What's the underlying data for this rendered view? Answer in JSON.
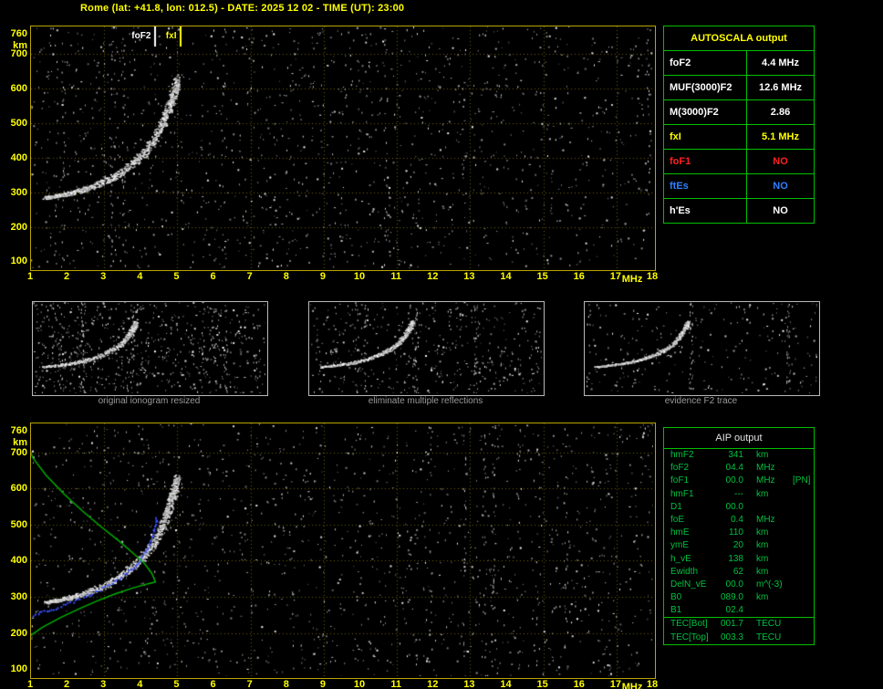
{
  "title": "Rome (lat: +41.8, lon: 012.5) - DATE: 2025 12 02 - TIME (UT): 23:00",
  "colors": {
    "accent_yellow": "#ffff00",
    "table_green": "#00c000",
    "aip_text_green": "#00c040",
    "alert_red": "#ff2020",
    "es_blue": "#2f7fff",
    "caption_gray": "#9a9a9a",
    "profile_green": "#00b400",
    "restored_blue": "#3a50ff",
    "axis_border": "#b9a500"
  },
  "autoscala_table": {
    "title": "AUTOSCALA output",
    "rows": [
      {
        "label": "foF2",
        "value": "4.4 MHz",
        "color": "#ffffff"
      },
      {
        "label": "MUF(3000)F2",
        "value": "12.6 MHz",
        "color": "#ffffff"
      },
      {
        "label": "M(3000)F2",
        "value": "2.86",
        "color": "#ffffff"
      },
      {
        "label": "fxI",
        "value": "5.1 MHz",
        "color": "#ffff00"
      },
      {
        "label": "foF1",
        "value": "NO",
        "color": "#ff2020"
      },
      {
        "label": "ftEs",
        "value": "NO",
        "color": "#2f7fff"
      },
      {
        "label": "h'Es",
        "value": "NO",
        "color": "#ffffff"
      }
    ]
  },
  "aip_table": {
    "title": "AIP output",
    "rows": [
      {
        "name": "hmF2",
        "value": "341",
        "unit": "km",
        "extra": ""
      },
      {
        "name": "foF2",
        "value": "04.4",
        "unit": "MHz",
        "extra": ""
      },
      {
        "name": "foF1",
        "value": "00.0",
        "unit": "MHz",
        "extra": "[PN]"
      },
      {
        "name": "hmF1",
        "value": "---",
        "unit": "km",
        "extra": ""
      },
      {
        "name": "D1",
        "value": "00.0",
        "unit": "",
        "extra": ""
      },
      {
        "name": "foE",
        "value": "0.4",
        "unit": "MHz",
        "extra": ""
      },
      {
        "name": "hmE",
        "value": "110",
        "unit": "km",
        "extra": ""
      },
      {
        "name": "ymE",
        "value": "20",
        "unit": "km",
        "extra": ""
      },
      {
        "name": "h_vE",
        "value": "138",
        "unit": "km",
        "extra": ""
      },
      {
        "name": "Ewidth",
        "value": "62",
        "unit": "km",
        "extra": ""
      },
      {
        "name": "DelN_vE",
        "value": "00.0",
        "unit": "m^(-3)",
        "extra": ""
      },
      {
        "name": "B0",
        "value": "089.0",
        "unit": "km",
        "extra": ""
      },
      {
        "name": "B1",
        "value": "02.4",
        "unit": "",
        "extra": ""
      },
      {
        "name": "TEC[Bot]",
        "value": "001.7",
        "unit": "TECU",
        "extra": "",
        "sep": true
      },
      {
        "name": "TEC[Top]",
        "value": "003.3",
        "unit": "TECU",
        "extra": ""
      }
    ]
  },
  "thumbnails": {
    "panels": [
      {
        "caption": "original ionogram resized"
      },
      {
        "caption": "eliminate multiple reflections"
      },
      {
        "caption": "evidence F2 trace"
      }
    ]
  },
  "chart_data": [
    {
      "type": "scatter",
      "name": "autoscala-ionogram",
      "xlabel": "MHz",
      "ylabel": "km",
      "xlim": [
        1,
        18
      ],
      "ylim": [
        100,
        760
      ],
      "x_ticks": [
        1,
        2,
        3,
        4,
        5,
        6,
        7,
        8,
        9,
        10,
        11,
        12,
        13,
        14,
        15,
        16,
        17,
        18
      ],
      "y_ticks": [
        760,
        700,
        600,
        500,
        400,
        300,
        200,
        100
      ],
      "grid_x_mhz": [
        3,
        5,
        7,
        9,
        11,
        13,
        15,
        17
      ],
      "grid_y_km": [
        200,
        300,
        400,
        500,
        600,
        700
      ],
      "markers": [
        {
          "label": "foF2",
          "freq_mhz": 4.4,
          "color": "#ffffff"
        },
        {
          "label": "fxI",
          "freq_mhz": 5.1,
          "color": "#ffff00"
        }
      ],
      "f2_trace_mhz_km": [
        [
          1.4,
          285
        ],
        [
          1.8,
          293
        ],
        [
          2.2,
          302
        ],
        [
          2.6,
          315
        ],
        [
          3.0,
          332
        ],
        [
          3.4,
          355
        ],
        [
          3.8,
          388
        ],
        [
          4.1,
          418
        ],
        [
          4.35,
          452
        ],
        [
          4.55,
          492
        ],
        [
          4.7,
          532
        ],
        [
          4.82,
          568
        ],
        [
          4.92,
          600
        ],
        [
          4.98,
          628
        ]
      ]
    },
    {
      "type": "scatter",
      "name": "aip-ionogram",
      "xlabel": "MHz",
      "ylabel": "km",
      "xlim": [
        1,
        18
      ],
      "ylim": [
        100,
        760
      ],
      "x_ticks": [
        1,
        2,
        3,
        4,
        5,
        6,
        7,
        8,
        9,
        10,
        11,
        12,
        13,
        14,
        15,
        16,
        17,
        18
      ],
      "y_ticks": [
        760,
        700,
        600,
        500,
        400,
        300,
        200,
        100
      ],
      "grid_x_mhz": [
        3,
        5,
        7,
        9,
        11,
        13,
        15,
        17
      ],
      "grid_y_km": [
        200,
        300,
        400,
        500,
        600,
        700
      ],
      "f2_trace_mhz_km": [
        [
          1.4,
          285
        ],
        [
          1.8,
          293
        ],
        [
          2.2,
          302
        ],
        [
          2.6,
          315
        ],
        [
          3.0,
          332
        ],
        [
          3.4,
          355
        ],
        [
          3.8,
          388
        ],
        [
          4.1,
          418
        ],
        [
          4.35,
          452
        ],
        [
          4.55,
          492
        ],
        [
          4.7,
          532
        ],
        [
          4.82,
          568
        ],
        [
          4.92,
          600
        ],
        [
          4.98,
          628
        ]
      ],
      "restored_trace_color": "#3a50ff",
      "restored_trace_mhz_km": [
        [
          1.05,
          250
        ],
        [
          1.4,
          262
        ],
        [
          1.8,
          275
        ],
        [
          2.2,
          290
        ],
        [
          2.6,
          308
        ],
        [
          3.0,
          328
        ],
        [
          3.4,
          352
        ],
        [
          3.75,
          380
        ],
        [
          4.0,
          408
        ],
        [
          4.2,
          440
        ],
        [
          4.3,
          470
        ],
        [
          4.38,
          500
        ],
        [
          4.42,
          525
        ]
      ],
      "profile_color": "#00b400",
      "profile_mhz_km": [
        [
          0.95,
          190
        ],
        [
          1.3,
          215
        ],
        [
          1.8,
          242
        ],
        [
          2.3,
          266
        ],
        [
          2.8,
          288
        ],
        [
          3.3,
          308
        ],
        [
          3.8,
          325
        ],
        [
          4.2,
          336
        ],
        [
          4.4,
          341
        ],
        [
          4.3,
          365
        ],
        [
          4.1,
          392
        ],
        [
          3.8,
          420
        ],
        [
          3.4,
          455
        ],
        [
          2.9,
          495
        ],
        [
          2.4,
          538
        ],
        [
          1.9,
          585
        ],
        [
          1.4,
          638
        ],
        [
          1.05,
          685
        ],
        [
          0.95,
          712
        ]
      ]
    }
  ]
}
